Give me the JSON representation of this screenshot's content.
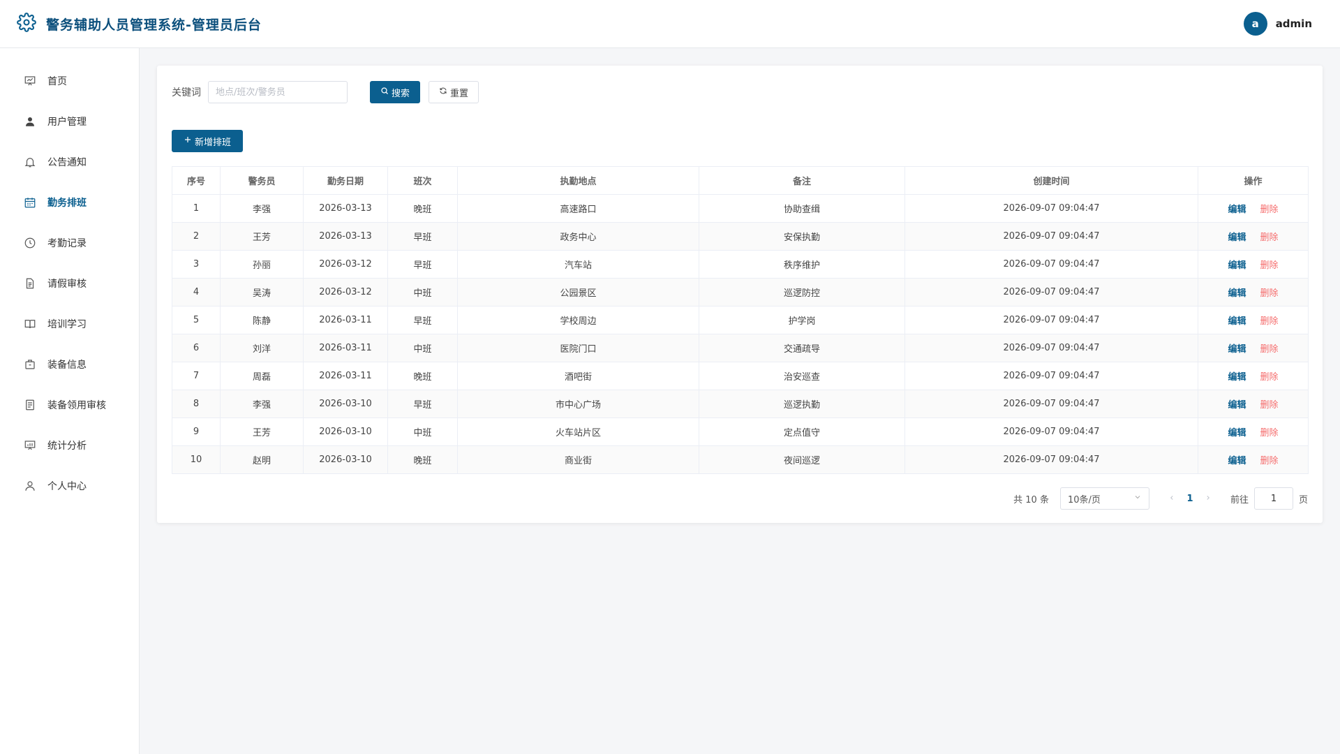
{
  "app": {
    "title": "警务辅助人员管理系统-管理员后台"
  },
  "user": {
    "avatar_letter": "a",
    "name": "admin"
  },
  "sidebar": {
    "items": [
      {
        "label": "首页",
        "icon": "dashboard-icon"
      },
      {
        "label": "用户管理",
        "icon": "user-icon"
      },
      {
        "label": "公告通知",
        "icon": "bell-icon"
      },
      {
        "label": "勤务排班",
        "icon": "calendar-icon",
        "active": true
      },
      {
        "label": "考勤记录",
        "icon": "clock-icon"
      },
      {
        "label": "请假审核",
        "icon": "document-icon"
      },
      {
        "label": "培训学习",
        "icon": "book-icon"
      },
      {
        "label": "装备信息",
        "icon": "briefcase-icon"
      },
      {
        "label": "装备领用审核",
        "icon": "list-icon"
      },
      {
        "label": "统计分析",
        "icon": "chart-icon"
      },
      {
        "label": "个人中心",
        "icon": "person-icon"
      }
    ]
  },
  "search": {
    "label": "关键词",
    "placeholder": "地点/班次/警务员",
    "value": "",
    "search_button": "搜索",
    "reset_button": "重置"
  },
  "toolbar": {
    "add_button": "新增排班"
  },
  "table": {
    "columns": [
      "序号",
      "警务员",
      "勤务日期",
      "班次",
      "执勤地点",
      "备注",
      "创建时间",
      "操作"
    ],
    "edit_label": "编辑",
    "delete_label": "删除",
    "rows": [
      [
        "1",
        "李强",
        "2026-03-13",
        "晚班",
        "高速路口",
        "协助查缉",
        "2026-09-07 09:04:47"
      ],
      [
        "2",
        "王芳",
        "2026-03-13",
        "早班",
        "政务中心",
        "安保执勤",
        "2026-09-07 09:04:47"
      ],
      [
        "3",
        "孙丽",
        "2026-03-12",
        "早班",
        "汽车站",
        "秩序维护",
        "2026-09-07 09:04:47"
      ],
      [
        "4",
        "吴涛",
        "2026-03-12",
        "中班",
        "公园景区",
        "巡逻防控",
        "2026-09-07 09:04:47"
      ],
      [
        "5",
        "陈静",
        "2026-03-11",
        "早班",
        "学校周边",
        "护学岗",
        "2026-09-07 09:04:47"
      ],
      [
        "6",
        "刘洋",
        "2026-03-11",
        "中班",
        "医院门口",
        "交通疏导",
        "2026-09-07 09:04:47"
      ],
      [
        "7",
        "周磊",
        "2026-03-11",
        "晚班",
        "酒吧街",
        "治安巡查",
        "2026-09-07 09:04:47"
      ],
      [
        "8",
        "李强",
        "2026-03-10",
        "早班",
        "市中心广场",
        "巡逻执勤",
        "2026-09-07 09:04:47"
      ],
      [
        "9",
        "王芳",
        "2026-03-10",
        "中班",
        "火车站片区",
        "定点值守",
        "2026-09-07 09:04:47"
      ],
      [
        "10",
        "赵明",
        "2026-03-10",
        "晚班",
        "商业街",
        "夜间巡逻",
        "2026-09-07 09:04:47"
      ]
    ]
  },
  "pagination": {
    "total_text": "共 10 条",
    "page_size": "10条/页",
    "current_page": "1",
    "goto_label": "前往",
    "goto_value": "1",
    "page_suffix": "页"
  },
  "colors": {
    "primary": "#0b5f8f",
    "danger": "#f56c6c",
    "brand_text": "#0b4f7c"
  }
}
